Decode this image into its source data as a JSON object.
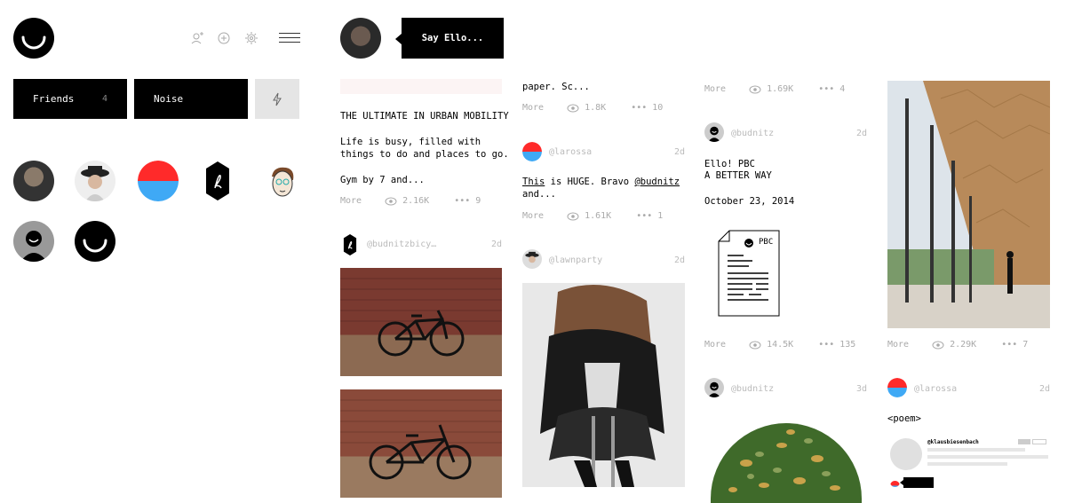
{
  "top_nav": {
    "logo_name": "ello-smile-logo",
    "icons": [
      "add-friend-icon",
      "plus-circle-icon",
      "gear-icon",
      "menu-icon"
    ]
  },
  "tabs": [
    {
      "label": "Friends",
      "count": "4"
    },
    {
      "label": "Noise",
      "count": ""
    }
  ],
  "composer": {
    "label": "Say Ello..."
  },
  "col1": {
    "post1": {
      "headline": "THE ULTIMATE IN URBAN MOBILITY",
      "body1": "Life is busy, filled with",
      "body2": "things to do and places to go.",
      "body3": "Gym by 7 and...",
      "more": "More",
      "views": "2.16K",
      "comments": "9"
    },
    "post2": {
      "username": "@budnitzbicy…",
      "ago": "2d"
    }
  },
  "col2": {
    "post1": {
      "body": "paper. Sc...",
      "more": "More",
      "views": "1.8K",
      "comments": "10"
    },
    "post2": {
      "username": "@larossa",
      "ago": "2d",
      "link1": "This",
      "text1": " is HUGE. Bravo ",
      "link2": "@budnitz",
      "text2": "and...",
      "more": "More",
      "views": "1.61K",
      "comments": "1"
    },
    "post3": {
      "username": "@lawnparty",
      "ago": "2d"
    }
  },
  "col3": {
    "post0": {
      "more": "More",
      "views": "1.69K",
      "comments": "4"
    },
    "post1": {
      "username": "@budnitz",
      "ago": "2d",
      "line1": "Ello! PBC",
      "line2": "A BETTER WAY",
      "date": "October 23, 2014",
      "doc_label": "PBC",
      "more": "More",
      "views": "14.5K",
      "comments": "135"
    },
    "post2": {
      "username": "@budnitz",
      "ago": "3d"
    }
  },
  "col4": {
    "post1": {
      "more": "More",
      "views": "2.29K",
      "comments": "7"
    },
    "post2": {
      "username": "@larossa",
      "ago": "2d",
      "body": "<poem>",
      "embed_user": "@klausbiesenbach"
    }
  },
  "colors": {
    "red": "#ff2a2a",
    "blue": "#3fa9f5",
    "black": "#000000",
    "gray": "#aaaaaa"
  }
}
